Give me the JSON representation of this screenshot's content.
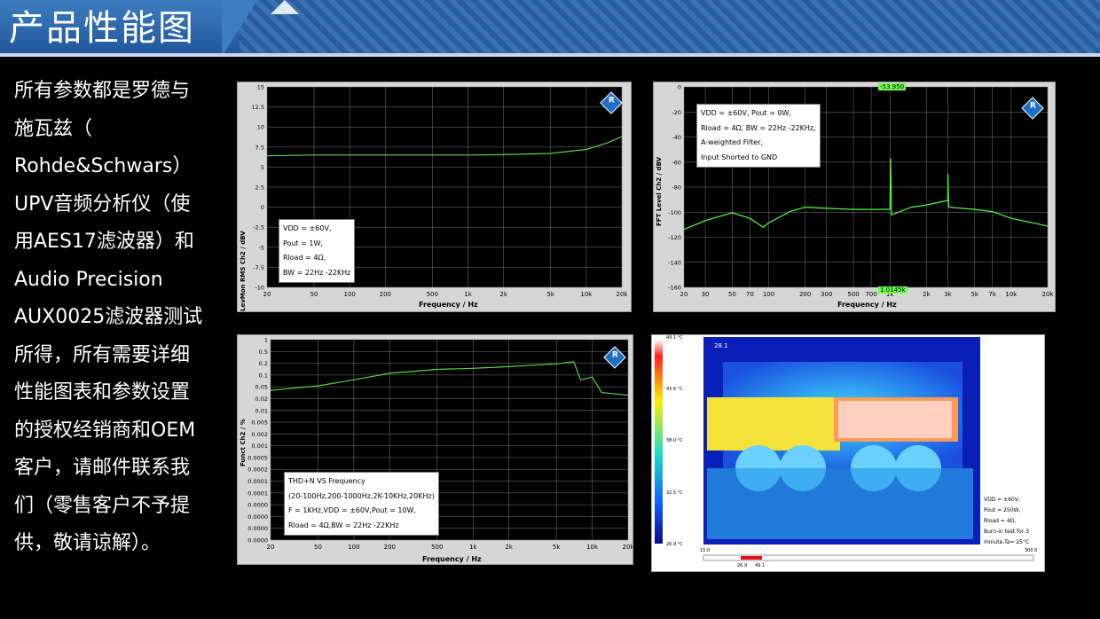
{
  "page": {
    "title": "产品性能图",
    "description_lines": [
      "所有参数都是罗德与",
      "施瓦兹（",
      "Rohde&Schwars）",
      "UPV音频分析仪（使",
      "用AES17滤波器）和",
      "Audio Precision",
      "AUX0025滤波器测试",
      "所得，所有需要详细",
      "性能图表和参数设置",
      "的授权经销商和OEM",
      "客户，请邮件联系我",
      "们（零售客户不予提",
      "供，敬请谅解）。"
    ]
  },
  "chart_data": [
    {
      "type": "line",
      "ylabel": "LevMon RMS Ch2 / dBV",
      "xlabel": "Frequency / Hz",
      "xscale": "log",
      "xlim": [
        20,
        20000
      ],
      "ylim": [
        -10,
        15
      ],
      "x_ticks": [
        "20",
        "50",
        "100",
        "200",
        "500",
        "1k",
        "2k",
        "5k",
        "10k",
        "20k"
      ],
      "y_ticks": [
        "15",
        "12.5",
        "10",
        "7.5",
        "5",
        "2.5",
        "0",
        "-2.5",
        "-5",
        "-7.5",
        "-10"
      ],
      "annotation": [
        "VDD = ±60V,",
        "Pout = 1W,",
        "Rload = 4Ω,",
        "BW = 22Hz -22KHz"
      ],
      "series": [
        {
          "x": [
            20,
            50,
            100,
            200,
            500,
            1000,
            2000,
            5000,
            10000,
            15000,
            20000
          ],
          "y": [
            6.4,
            6.5,
            6.5,
            6.5,
            6.5,
            6.5,
            6.55,
            6.7,
            7.2,
            8.0,
            8.8
          ]
        }
      ]
    },
    {
      "type": "line",
      "ylabel": "FFT Level Ch2 / dBV",
      "xlabel": "Frequency / Hz",
      "xscale": "log",
      "xlim": [
        20,
        20000
      ],
      "ylim": [
        -170,
        10
      ],
      "x_ticks": [
        "20",
        "30",
        "50",
        "70",
        "100",
        "200",
        "300",
        "500",
        "700",
        "1k",
        "2k",
        "3k",
        "5k",
        "7k",
        "10k",
        "20k"
      ],
      "y_ticks": [
        "0",
        "-20",
        "-40",
        "-60",
        "-80",
        "-100",
        "-120",
        "-140",
        "-160"
      ],
      "markers": [
        "-53.950",
        "1.0145k"
      ],
      "annotation": [
        "VDD = ±60V, Pout = 0W,",
        "Rload = 4Ω, BW = 22Hz -22KHz,",
        "A-weighted Filter,",
        "Input Shorted to GND"
      ],
      "series": [
        {
          "x": [
            20,
            30,
            50,
            70,
            90,
            100,
            150,
            200,
            300,
            500,
            700,
            1000,
            1014.5,
            1030,
            1500,
            2000,
            3000,
            3010,
            3050,
            5000,
            7000,
            10000,
            15000,
            20000
          ],
          "y": [
            -118,
            -110,
            -103,
            -108,
            -116,
            -112,
            -102,
            -98,
            -99,
            -100,
            -100,
            -100,
            -54,
            -105,
            -98,
            -96,
            -92,
            -68,
            -98,
            -100,
            -102,
            -108,
            -112,
            -115
          ]
        }
      ]
    },
    {
      "type": "line",
      "ylabel": "Funct Ch2 / %",
      "xlabel": "Frequency / Hz",
      "xscale": "log",
      "xlim": [
        20,
        20000
      ],
      "x_ticks": [
        "20",
        "50",
        "100",
        "200",
        "500",
        "1k",
        "2k",
        "5k",
        "10k",
        "20k"
      ],
      "y_ticks": [
        "1",
        "0.5",
        "0.2",
        "0.1",
        "0.05",
        "0.02",
        "0.01",
        "0.005",
        "0.002",
        "0.001",
        "0.0005",
        "0.0002",
        "0.0001",
        "0.0001",
        "0.0000",
        "0.0000",
        "0.0000",
        "0.0000"
      ],
      "annotation": [
        "THD+N VS  Frequency",
        "(20-100Hz,200-1000Hz,2K-10KHz,20KHz)",
        "F = 1KHz,VDD = ±60V,Pout = 10W,",
        "Rload = 4Ω,BW = 22Hz -22KHz"
      ],
      "series": [
        {
          "x": [
            20,
            50,
            100,
            200,
            500,
            1000,
            2000,
            5000,
            7000,
            8000,
            10000,
            12000,
            20000
          ],
          "y": [
            0.005,
            0.008,
            0.015,
            0.03,
            0.045,
            0.05,
            0.06,
            0.08,
            0.1,
            0.015,
            0.02,
            0.004,
            0.003
          ]
        }
      ]
    }
  ],
  "thermal": {
    "spot_label": "28.1",
    "scale_labels": [
      "49.1 °C",
      "43.6 °C",
      "38.0 °C",
      "32.5 °C",
      "26.9 °C"
    ],
    "bottom_range": [
      "15.0",
      "300.0"
    ],
    "bottom_marks": [
      "26.9",
      "49.1"
    ],
    "info_lines": [
      "VDD = ±60V,",
      "Pout = 250W,",
      "Rload = 4Ω,",
      "Burn-in test for 3",
      "minute,Ta= 25°C"
    ]
  },
  "colors": {
    "banner": "#2a5d9c",
    "plot_bg": "#000000",
    "trace": "#5fd14a",
    "fft_trace": "#4cff3a",
    "grid": "#7a7a7a"
  }
}
